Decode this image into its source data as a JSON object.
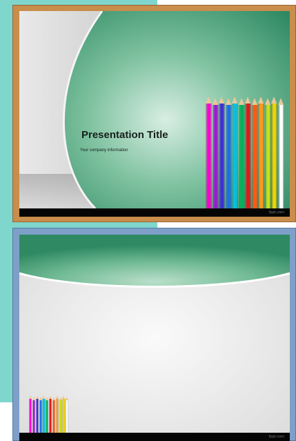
{
  "slides": [
    {
      "title": "Presentation Title",
      "subtitle": "Your company information",
      "footer_mark": "fppt.com",
      "frame_color": "#c98d4c",
      "accent_color": "#2f8a63"
    },
    {
      "footer_mark": "fppt.com",
      "frame_color": "#7ea0c8",
      "accent_color": "#2f8a63"
    }
  ],
  "pencil_colors": [
    "#ff00cc",
    "#9b1bd0",
    "#3f2fd6",
    "#1b6fe8",
    "#00c2e0",
    "#00b35a",
    "#e01818",
    "#ff5a12",
    "#ff9a1a",
    "#c7e214",
    "#f2d400",
    "#ffffff"
  ],
  "pencil_icon": "colored-pencils-icon"
}
